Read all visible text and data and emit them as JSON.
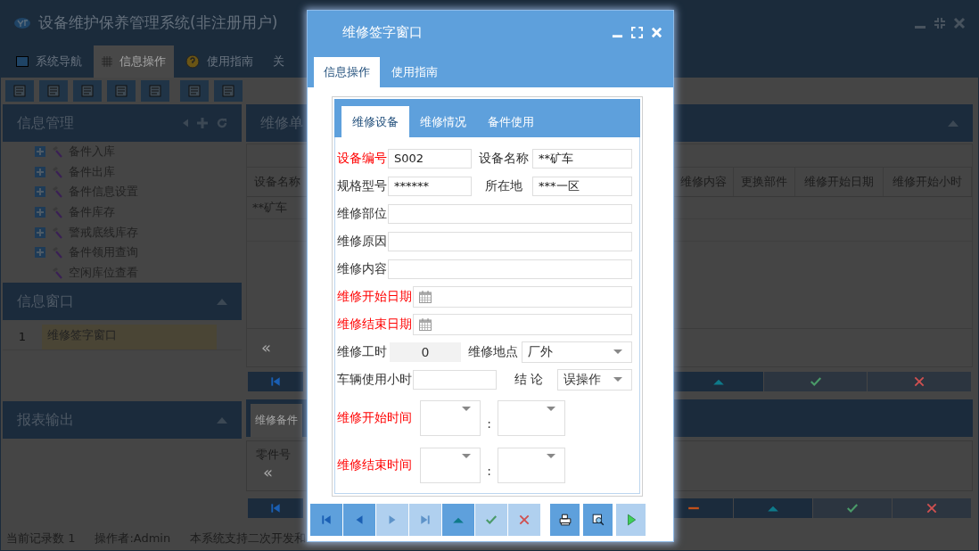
{
  "app": {
    "title": "设备维护保养管理系统(非注册用户)",
    "tabs": [
      {
        "label": "系统导航",
        "selected": false
      },
      {
        "label": "信息操作",
        "selected": true
      },
      {
        "label": "使用指南",
        "selected": false
      },
      {
        "label": "关",
        "selected": false
      }
    ]
  },
  "sidebar": {
    "title": "信息管理",
    "items": [
      {
        "label": "备件入库",
        "expandable": true
      },
      {
        "label": "备件出库",
        "expandable": true
      },
      {
        "label": "备件信息设置",
        "expandable": true
      },
      {
        "label": "备件库存",
        "expandable": true
      },
      {
        "label": "警戒底线库存",
        "expandable": true
      },
      {
        "label": "备件领用查询",
        "expandable": true
      },
      {
        "label": "空闲库位查看",
        "expandable": false
      }
    ]
  },
  "info_window": {
    "title": "信息窗口",
    "rows": [
      {
        "index": "1",
        "label": "维修签字窗口",
        "selected": true
      }
    ]
  },
  "report": {
    "title": "报表输出"
  },
  "main_panel": {
    "title": "维修单",
    "columns_left": [
      "设备名称"
    ],
    "columns_right": [
      "维修内容",
      "更换部件",
      "维修开始日期",
      "维修开始小时"
    ],
    "rows": [
      [
        "**矿车"
      ]
    ],
    "pager": "«",
    "left_buttons": [
      {
        "kind": "first",
        "disabled": false
      }
    ],
    "right_buttons": [
      {
        "kind": "up",
        "disabled": false
      },
      {
        "kind": "ok",
        "disabled": true
      },
      {
        "kind": "cancel",
        "disabled": true
      }
    ]
  },
  "parts_panel": {
    "tab": "维修备件",
    "column": "零件号",
    "pager": "«",
    "left_buttons": [
      {
        "kind": "first",
        "disabled": false
      }
    ],
    "right_buttons": [
      {
        "kind": "minus",
        "disabled": false
      },
      {
        "kind": "up",
        "disabled": false
      },
      {
        "kind": "ok",
        "disabled": true
      },
      {
        "kind": "cancel",
        "disabled": true
      }
    ]
  },
  "status_bar": [
    "当前记录数 1",
    "操作者:Admin",
    "本系统支持二次开发和"
  ],
  "dialog": {
    "title": "维修签字窗口",
    "tabs": [
      {
        "label": "信息操作",
        "selected": true
      },
      {
        "label": "使用指南",
        "selected": false
      }
    ],
    "form_tabs": [
      {
        "label": "维修设备",
        "selected": true
      },
      {
        "label": "维修情况",
        "selected": false
      },
      {
        "label": "备件使用",
        "selected": false
      }
    ],
    "rows": [
      [
        {
          "label": "设备编号",
          "required": true,
          "kind": "text",
          "value": "S002"
        },
        {
          "label": "设备名称",
          "required": false,
          "kind": "text",
          "value": "**矿车"
        }
      ],
      [
        {
          "label": "规格型号",
          "required": false,
          "kind": "text",
          "value": "******"
        },
        {
          "label": "所在地",
          "required": false,
          "kind": "text",
          "value": "***一区"
        }
      ],
      [
        {
          "label": "维修部位",
          "required": false,
          "kind": "text"
        }
      ],
      [
        {
          "label": "维修原因",
          "required": false,
          "kind": "text"
        }
      ],
      [
        {
          "label": "维修内容",
          "required": false,
          "kind": "text"
        }
      ],
      [
        {
          "label": "维修开始日期",
          "required": true,
          "kind": "date"
        }
      ],
      [
        {
          "label": "维修结束日期",
          "required": true,
          "kind": "date"
        }
      ],
      [
        {
          "label": "维修工时",
          "required": false,
          "kind": "readonly",
          "value": "0"
        },
        {
          "label": "维修地点",
          "required": false,
          "kind": "select",
          "value": "厂外"
        }
      ],
      [
        {
          "label": "车辆使用小时",
          "required": false,
          "kind": "text"
        },
        {
          "label": "结 论",
          "required": false,
          "kind": "select",
          "value": "误操作"
        }
      ],
      [
        {
          "label": "维修开始时间",
          "required": true,
          "kind": "time",
          "separator": ":"
        }
      ],
      [
        {
          "label": "维修结束时间",
          "required": true,
          "kind": "time",
          "separator": ":"
        }
      ]
    ],
    "buttons": [
      {
        "kind": "first",
        "disabled": false
      },
      {
        "kind": "prev",
        "disabled": false
      },
      {
        "kind": "next",
        "disabled": true
      },
      {
        "kind": "last",
        "disabled": true
      },
      {
        "kind": "up",
        "disabled": false
      },
      {
        "kind": "ok",
        "disabled": true
      },
      {
        "kind": "cancel",
        "disabled": true
      }
    ],
    "tools": [
      {
        "kind": "print",
        "disabled": false
      },
      {
        "kind": "preview",
        "disabled": false
      },
      {
        "kind": "run",
        "disabled": true
      }
    ]
  }
}
